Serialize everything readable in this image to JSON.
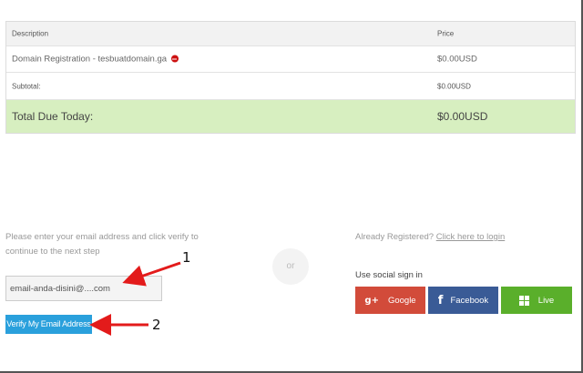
{
  "cart": {
    "header": {
      "description": "Description",
      "price": "Price"
    },
    "item": {
      "description": "Domain Registration - tesbuatdomain.ga",
      "price": "$0.00USD",
      "remove_icon": "remove-icon"
    },
    "subtotal": {
      "label": "Subtotal:",
      "value": "$0.00USD"
    },
    "total": {
      "label": "Total Due Today:",
      "value": "$0.00USD"
    }
  },
  "verify": {
    "instructions": "Please enter your email address and click verify to continue to the next step",
    "email_value": "email-anda-disini@....com",
    "button_label": "Verify My Email Address"
  },
  "divider": {
    "or": "or"
  },
  "login": {
    "already_text": "Already Registered?",
    "link_text": "Click here to login"
  },
  "social": {
    "label": "Use social sign in",
    "google": {
      "label": "Google",
      "icon": "g+",
      "color": "#d24b3a"
    },
    "facebook": {
      "label": "Facebook",
      "icon": "f",
      "color": "#3a5b96"
    },
    "live": {
      "label": "Live",
      "icon": "windows-icon",
      "color": "#5aaf2b"
    }
  },
  "annotations": {
    "one": "1",
    "two": "2",
    "color": "#e31b1b"
  }
}
